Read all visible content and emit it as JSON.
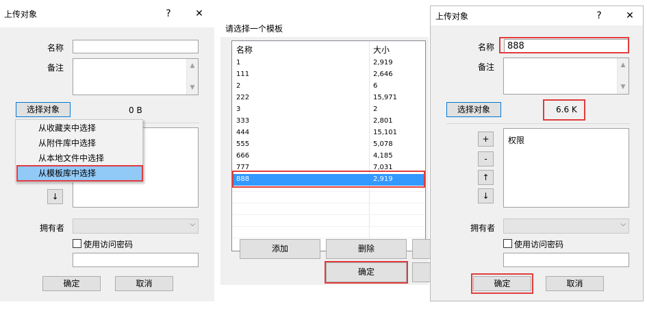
{
  "left_dialog": {
    "title": "上传对象",
    "help": "?",
    "close": "✕",
    "name_label": "名称",
    "name_value": "",
    "note_label": "备注",
    "select_button": "选择对象",
    "size": "0 B",
    "menu": [
      "从收藏夹中选择",
      "从附件库中选择",
      "从本地文件中选择",
      "从模板库中选择"
    ],
    "down_button": "↓",
    "owner_label": "拥有者",
    "password_checkbox": "使用访问密码",
    "ok": "确定",
    "cancel": "取消"
  },
  "middle_dialog": {
    "title": "请选择一个模板",
    "columns": [
      "名称",
      "大小"
    ],
    "rows": [
      {
        "name": "1",
        "size": "2,919"
      },
      {
        "name": "111",
        "size": "2,646"
      },
      {
        "name": "2",
        "size": "6"
      },
      {
        "name": "222",
        "size": "15,971"
      },
      {
        "name": "3",
        "size": "2"
      },
      {
        "name": "333",
        "size": "2,801"
      },
      {
        "name": "444",
        "size": "15,101"
      },
      {
        "name": "555",
        "size": "5,078"
      },
      {
        "name": "666",
        "size": "4,185"
      },
      {
        "name": "777",
        "size": "7,031"
      },
      {
        "name": "888",
        "size": "2,919"
      }
    ],
    "selected": "888",
    "add": "添加",
    "delete": "删除",
    "ok": "确定"
  },
  "right_dialog": {
    "title": "上传对象",
    "help": "?",
    "close": "✕",
    "name_label": "名称",
    "name_value": "888",
    "note_label": "备注",
    "select_button": "选择对象",
    "size": "6.6 K",
    "plus": "+",
    "minus": "-",
    "up": "↑",
    "down": "↓",
    "permission": "权限",
    "owner_label": "拥有者",
    "password_checkbox": "使用访问密码",
    "ok": "确定",
    "cancel": "取消"
  },
  "colors": {
    "highlight_red": "#e03c3c",
    "selection_blue": "#3399ff",
    "menu_highlight": "#91c9f7",
    "button_focus_blue": "#0078d7"
  }
}
